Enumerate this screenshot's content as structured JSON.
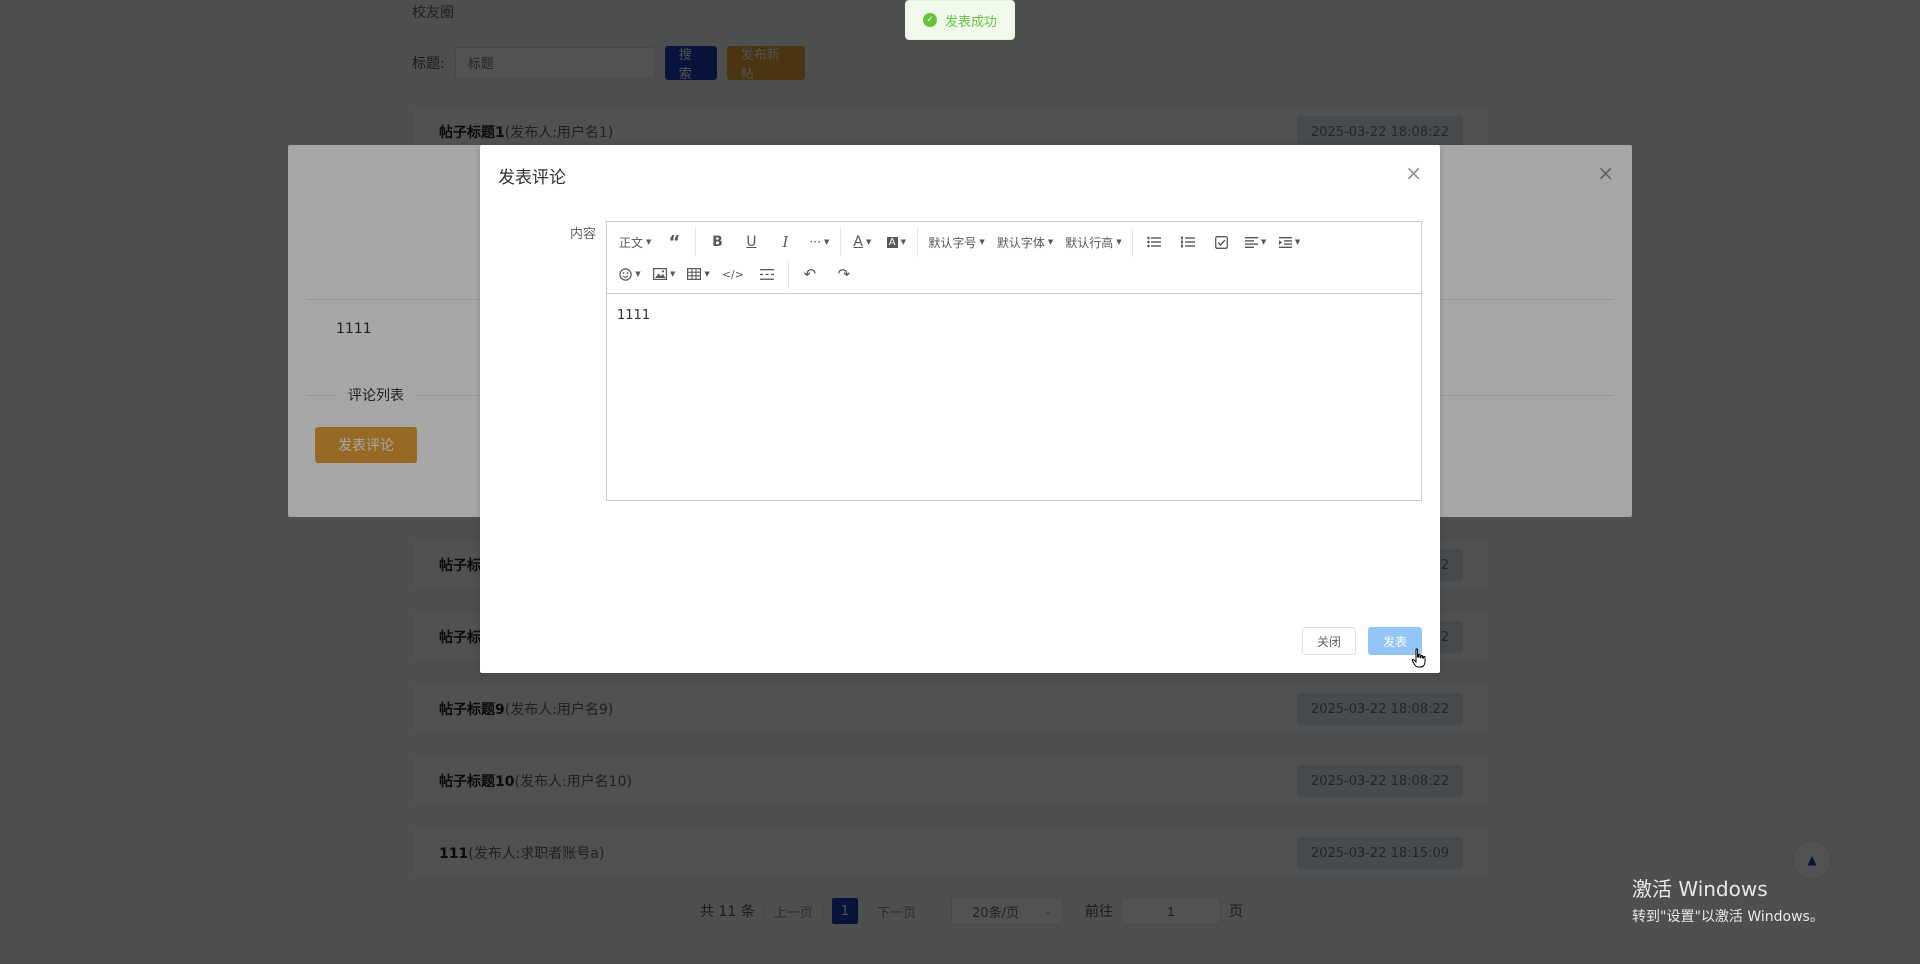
{
  "breadcrumb": "校友圈",
  "search": {
    "label": "标题:",
    "placeholder": "标题",
    "search_button": "搜索",
    "publish_button": "发布新帖"
  },
  "posts": [
    {
      "title": "帖子标题1",
      "meta": "(发布人:用户名1)",
      "date": "2025-03-22 18:08:22"
    },
    {
      "title": "帖子标",
      "meta": "",
      "date": "22"
    },
    {
      "title": "帖子标",
      "meta": "",
      "date": "22"
    },
    {
      "title": "帖子标题9",
      "meta": "(发布人:用户名9)",
      "date": "2025-03-22 18:08:22"
    },
    {
      "title": "帖子标题10",
      "meta": "(发布人:用户名10)",
      "date": "2025-03-22 18:08:22"
    },
    {
      "title": "111",
      "meta": "(发布人:求职者账号a)",
      "date": "2025-03-22 18:15:09"
    }
  ],
  "pagination": {
    "total": "共 11 条",
    "prev": "上一页",
    "current": "1",
    "next": "下一页",
    "page_size": "20条/页",
    "goto_label": "前往",
    "goto_value": "1",
    "page_suffix": "页"
  },
  "detail_dialog": {
    "content": "1111",
    "comment_list_label": "评论列表",
    "comment_button": "发表评论"
  },
  "comment_dialog": {
    "title": "发表评论",
    "content_label": "内容",
    "toolbar": {
      "heading": "正文",
      "font_size": "默认字号",
      "font_family": "默认字体",
      "line_height": "默认行高"
    },
    "editor_text": "1111",
    "close_button": "关闭",
    "submit_button": "发表"
  },
  "toast": {
    "message": "发表成功"
  },
  "watermark": {
    "line1": "激活 Windows",
    "line2": "转到\"设置\"以激活 Windows。"
  },
  "colors": {
    "primary_blue": "#1e3fb8",
    "accent_orange": "#e6a33a",
    "success_green": "#67c23a",
    "submit_light_blue": "#93c5f7"
  }
}
